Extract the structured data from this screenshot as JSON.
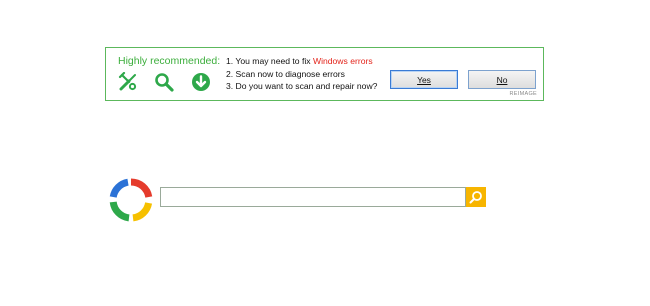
{
  "banner": {
    "title": "Highly recommended:",
    "icons": [
      "tools-icon",
      "search-icon",
      "download-icon"
    ],
    "steps": {
      "line1_prefix": "1. You may need to fix ",
      "line1_highlight": "Windows errors",
      "line2": "2. Scan now to diagnose errors",
      "line3": "3. Do you want to scan and repair now?"
    },
    "yes_label": "Yes",
    "no_label": "No",
    "brand": "REIMAGE"
  },
  "search": {
    "input_value": "",
    "placeholder": ""
  },
  "colors": {
    "banner_border": "#5cb85c",
    "accent_green": "#3cae3c",
    "error_red": "#e3241b",
    "search_button": "#f7b500",
    "logo_red": "#e53b2c",
    "logo_green": "#2ea84a",
    "logo_blue": "#2b72d6",
    "logo_yellow": "#f6c000"
  }
}
